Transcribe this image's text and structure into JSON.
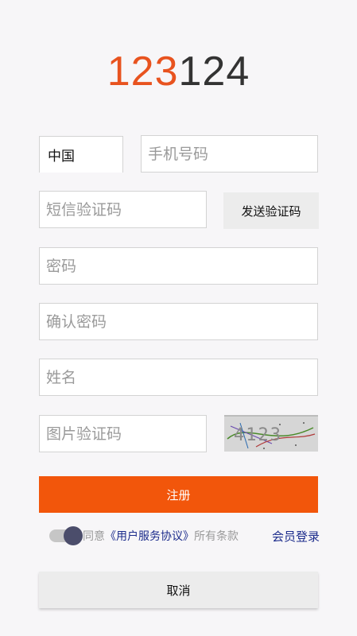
{
  "logo": {
    "part1": "123",
    "part2": "124"
  },
  "country_code": "中国",
  "phone": {
    "placeholder": "手机号码",
    "value": ""
  },
  "sms_code": {
    "placeholder": "短信验证码",
    "value": ""
  },
  "send_code_label": "发送验证码",
  "password": {
    "placeholder": "密码",
    "value": ""
  },
  "confirm_password": {
    "placeholder": "确认密码",
    "value": ""
  },
  "name": {
    "placeholder": "姓名",
    "value": ""
  },
  "image_code": {
    "placeholder": "图片验证码",
    "value": ""
  },
  "captcha_text": "4123",
  "register_label": "注册",
  "agreement": {
    "prefix": "同意",
    "link": "《用户服务协议》",
    "suffix": "所有条款",
    "toggle_on": true
  },
  "member_login_label": "会员登录",
  "cancel_label": "取消",
  "colors": {
    "accent": "#f2560b",
    "link": "#1c2c8c",
    "logo_orange": "#e8531f"
  }
}
